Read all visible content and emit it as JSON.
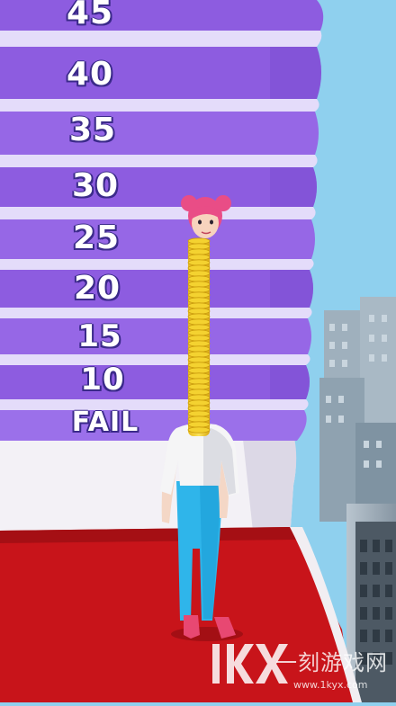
{
  "score_rings": [
    {
      "label": "45"
    },
    {
      "label": "40"
    },
    {
      "label": "35"
    },
    {
      "label": "30"
    },
    {
      "label": "25"
    },
    {
      "label": "20"
    },
    {
      "label": "15"
    },
    {
      "label": "10"
    },
    {
      "label": "FAIL"
    }
  ],
  "watermark": {
    "logo_text": "1kx",
    "cn_text": "一刻游戏网",
    "url": "www.1kyx.com"
  },
  "colors": {
    "sky": "#8fd0ee",
    "ring_purple": "#8d5ce0",
    "ring_light": "#e4dcfa",
    "floor_red": "#c8141a",
    "neck_yellow": "#f4d230",
    "hair_pink": "#e94d86",
    "jeans_blue": "#2fb5ea",
    "shoes_pink": "#e84872"
  }
}
